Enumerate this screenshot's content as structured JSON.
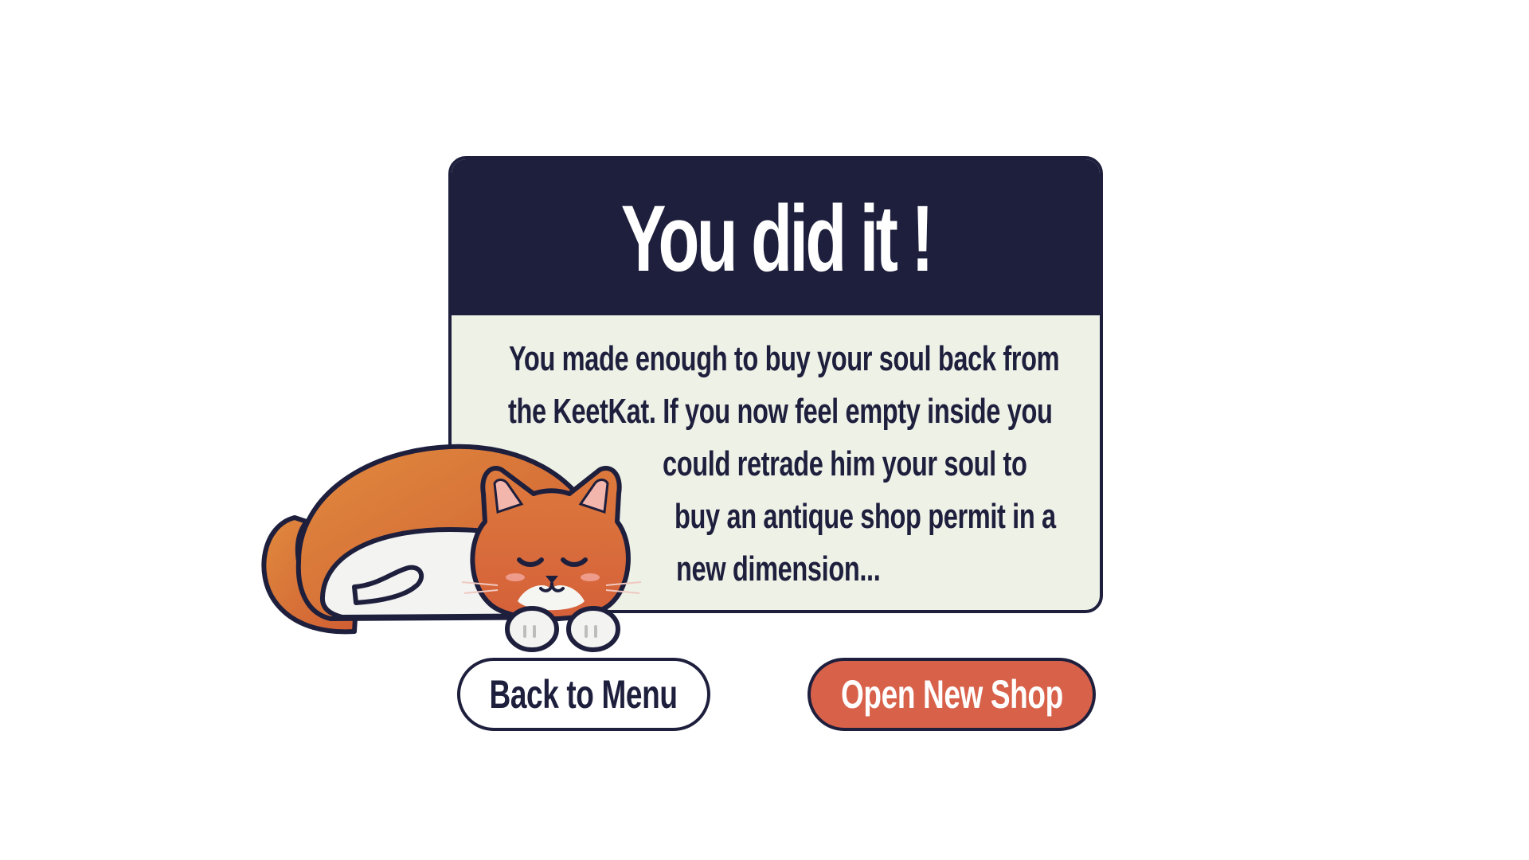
{
  "dialog": {
    "title": "You did it !",
    "message_lines": [
      "You made enough to buy your soul back from",
      "the KeetKat. If you now feel empty inside you",
      "could retrade him your soul to",
      "buy an antique shop permit in a",
      "new dimension..."
    ]
  },
  "buttons": {
    "back_to_menu": "Back to Menu",
    "open_new_shop": "Open New Shop"
  },
  "mascot": {
    "icon": "sleeping-cat-icon"
  },
  "colors": {
    "header_bg": "#1e1f3d",
    "panel_bg": "#eef1e6",
    "accent": "#d8614a",
    "cat_orange": "#d97a3c",
    "text_dark": "#1e1f3d"
  }
}
